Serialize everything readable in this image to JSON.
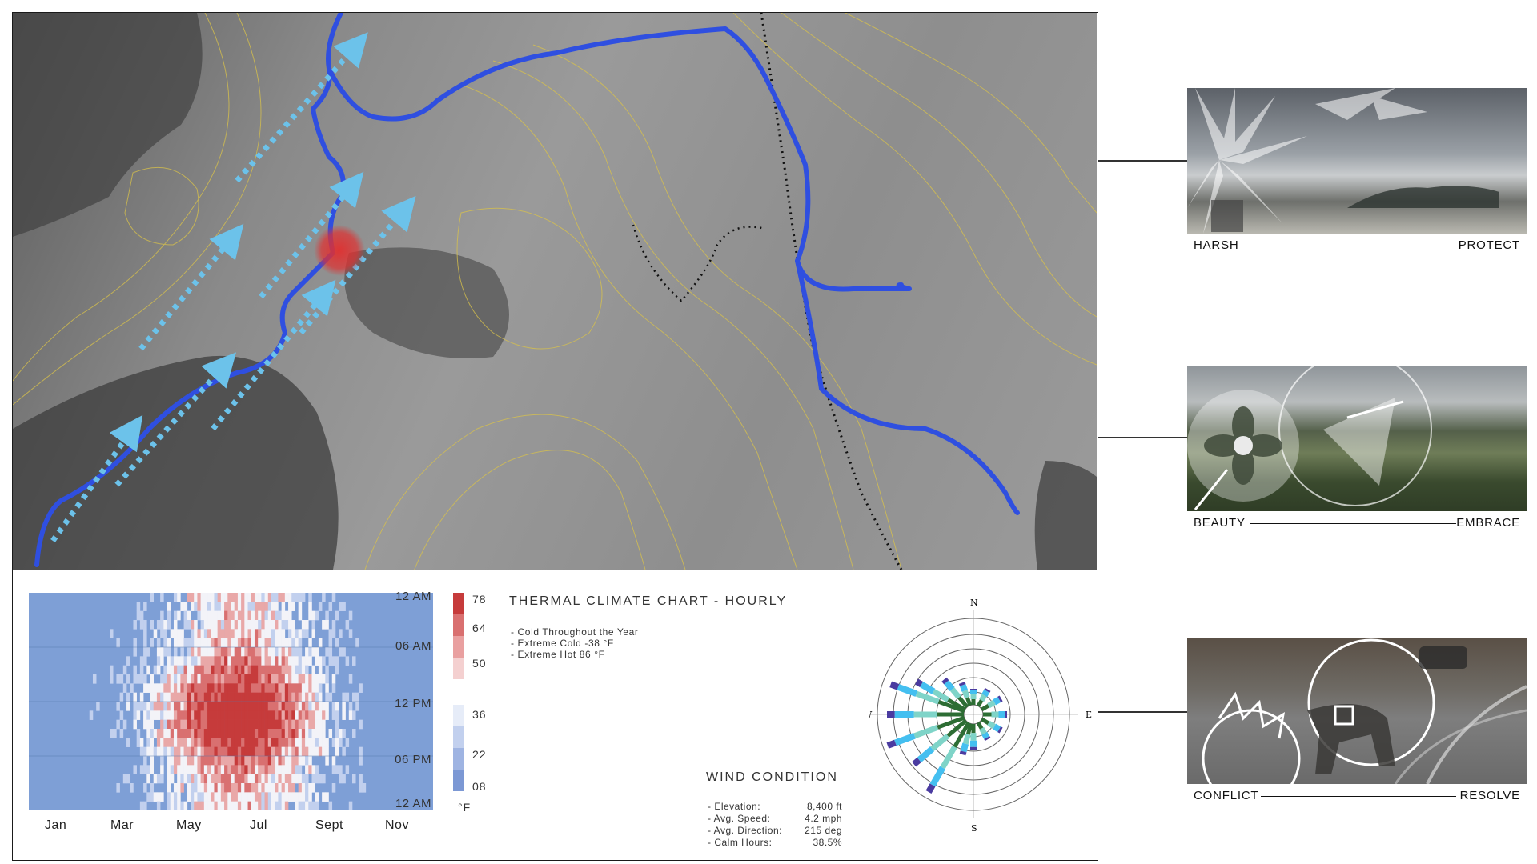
{
  "heatmap": {
    "y_ticks": [
      "12 AM",
      "06 AM",
      "12 PM",
      "06 PM",
      "12 AM"
    ],
    "x_ticks": [
      "Jan",
      "Mar",
      "May",
      "Jul",
      "Sept",
      "Nov"
    ],
    "colors": {
      "cold": "#7e9fd6",
      "hot": "#c23b3b",
      "neutral": "#f4f4f8"
    }
  },
  "legend": {
    "hot_labels": [
      "78",
      "64",
      "50"
    ],
    "cold_labels": [
      "36",
      "22",
      "08"
    ],
    "unit": "°F",
    "hot_colors": [
      "#c63b3b",
      "#d97070",
      "#e9a0a0",
      "#f4d0d0"
    ],
    "cold_colors": [
      "#e6ecf8",
      "#c2d0ee",
      "#9fb4e2",
      "#7c98d4"
    ]
  },
  "thermal": {
    "title": "THERMAL CLIMATE CHART - HOURLY",
    "notes": [
      "- Cold Throughout the Year",
      "- Extreme Cold -38 °F",
      "- Extreme Hot  86 °F"
    ]
  },
  "wind": {
    "title": "WIND CONDITION",
    "rows": [
      {
        "label": "- Elevation:",
        "value": "8,400 ft"
      },
      {
        "label": "- Avg. Speed:",
        "value": "4.2 mph"
      },
      {
        "label": "- Avg. Direction:",
        "value": "215 deg"
      },
      {
        "label": "- Calm Hours:",
        "value": "38.5%"
      }
    ],
    "compass": {
      "n": "N",
      "e": "E",
      "s": "S",
      "w": "W"
    }
  },
  "panels": [
    {
      "left": "HARSH",
      "right": "PROTECT"
    },
    {
      "left": "BEAUTY",
      "right": "EMBRACE"
    },
    {
      "left": "CONFLICT",
      "right": "RESOLVE"
    }
  ],
  "map_colors": {
    "river": "#2f4fe0",
    "wind_arrows": "#6cc2ea",
    "contours": "#d9c24a",
    "hotspot": "#e03030"
  }
}
